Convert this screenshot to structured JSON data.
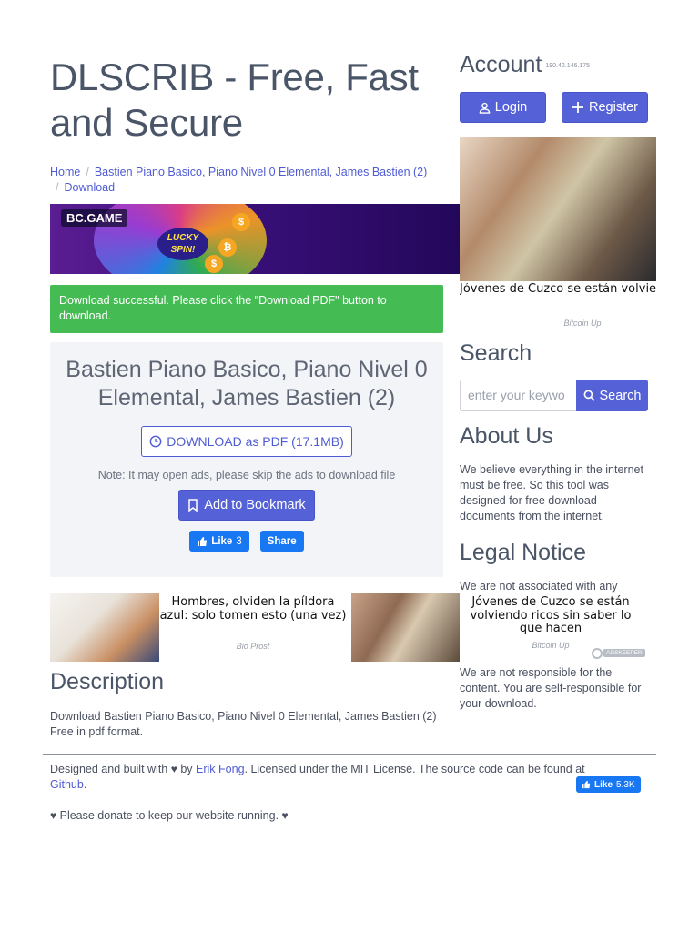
{
  "site": {
    "title": "DLSCRIB - Free, Fast and Secure"
  },
  "breadcrumb": {
    "home": "Home",
    "item": "Bastien Piano Basico, Piano Nivel 0 Elemental, James Bastien (2)",
    "current": "Download"
  },
  "banner": {
    "brand": "BC.GAME",
    "spin": "LUCKY SPIN!"
  },
  "alert": {
    "message": "Download successful. Please click the \"Download PDF\" button to download."
  },
  "document": {
    "title": "Bastien Piano Basico, Piano Nivel 0 Elemental, James Bastien (2)",
    "download_label": "DOWNLOAD as PDF (17.1MB)",
    "note": "Note: It may open ads, please skip the ads to download file",
    "bookmark_label": "Add to Bookmark",
    "like_label": "Like",
    "like_count": "3",
    "share_label": "Share"
  },
  "ads": {
    "left_headline": "Hombres, olviden la píldora azul: solo tomen esto (una vez)",
    "left_source": "Bio Prost",
    "mid_headline": "Jóvenes de Cuzco se están volviendo ricos sin saber lo que hacen",
    "mid_source": "Bitcoin Up",
    "side_headline": "Jóvenes de Cuzco se están volviendo ricos sin saber lo que hacen",
    "side_source": "Bitcoin Up",
    "adskeeper": "ADSKEEPER"
  },
  "description": {
    "heading": "Description",
    "text": "Download Bastien Piano Basico, Piano Nivel 0 Elemental, James Bastien (2) Free in pdf format."
  },
  "account": {
    "heading": "Account",
    "ip": "190.42.146.175",
    "login_label": "Login",
    "register_label": "Register"
  },
  "search": {
    "heading": "Search",
    "placeholder": "enter your keywo",
    "button_label": "Search"
  },
  "about": {
    "heading": "About Us",
    "text": "We believe everything in the internet must be free. So this tool was designed for free download documents from the internet."
  },
  "legal": {
    "heading": "Legal Notice",
    "text_top": "We are not associated with any",
    "text_bottom": "We are not responsible for the content. You are self-responsible for your download."
  },
  "footer": {
    "designed_prefix": "Designed and built with",
    "by": "by",
    "author": "Erik Fong",
    "license_text": ". Licensed under the MIT License. The source code can be found at",
    "github": "Github",
    "like_label": "Like",
    "like_count": "5.3K",
    "donate": "Please donate to keep our website running."
  },
  "colors": {
    "primary": "#5561d6",
    "success": "#45bb54",
    "facebook": "#1877f2",
    "link": "#4f5bd5"
  }
}
